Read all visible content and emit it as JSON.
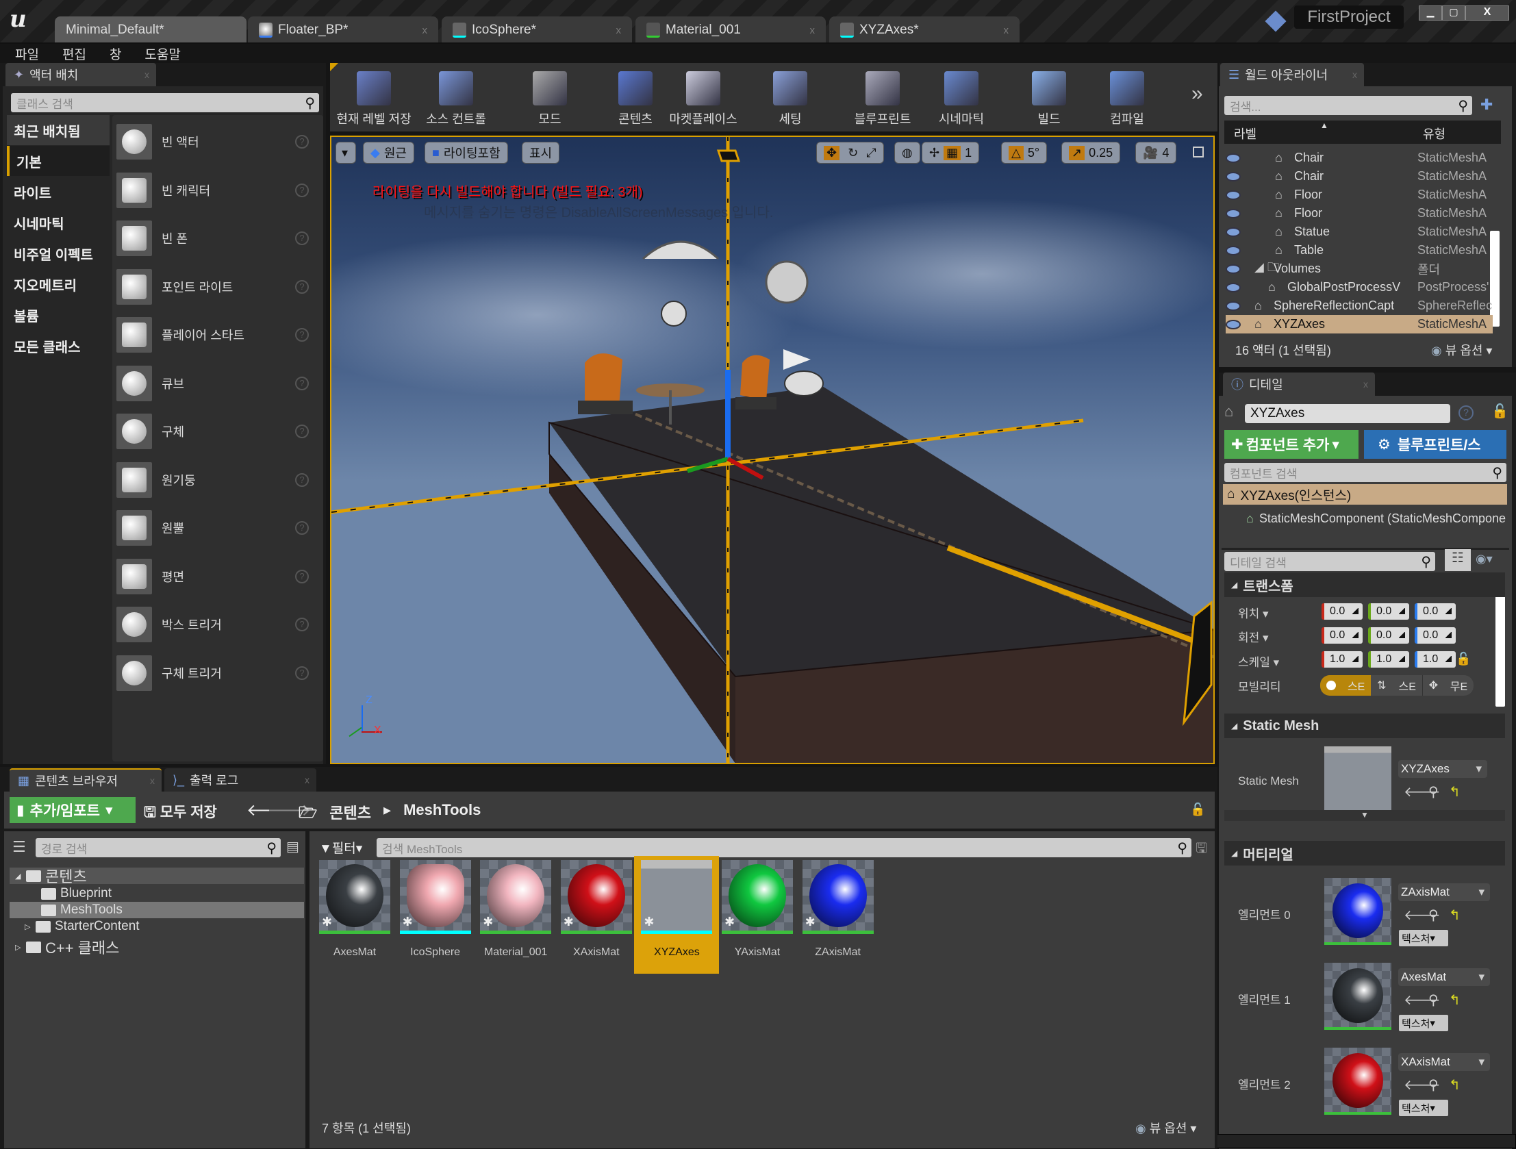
{
  "window": {
    "project": "FirstProject",
    "tabs": [
      "Minimal_Default*",
      "Floater_BP*",
      "IcoSphere*",
      "Material_001",
      "XYZAxes*"
    ]
  },
  "menu": [
    "파일",
    "편집",
    "창",
    "도움말"
  ],
  "place_actors": {
    "tab": "액터 배치",
    "search_placeholder": "클래스 검색",
    "categories": [
      "최근 배치됨",
      "기본",
      "라이트",
      "시네마틱",
      "비주얼 이펙트",
      "지오메트리",
      "볼륨",
      "모든 클래스"
    ],
    "items": [
      "빈 액터",
      "빈 캐릭터",
      "빈 폰",
      "포인트 라이트",
      "플레이어 스타트",
      "큐브",
      "구체",
      "원기둥",
      "원뿔",
      "평면",
      "박스 트리거",
      "구체 트리거"
    ]
  },
  "toolbar": [
    "현재 레벨 저장",
    "소스 컨트롤",
    "모드",
    "콘텐츠",
    "마켓플레이스",
    "세팅",
    "블루프린트",
    "시네마틱",
    "빌드",
    "컴파일"
  ],
  "viewport": {
    "perspective": "원근",
    "lit": "라이팅포함",
    "show": "표시",
    "grid": "1",
    "rot_snap": "5°",
    "scale_snap": "0.25",
    "cam_speed": "4",
    "warning": "라이팅을 다시 빌드해야 합니다 (빌드 필요: 3개)",
    "hint": "메시지를 숨기는 명령은 DisableAllScreenMessages 입니다.",
    "axis_z": "Z",
    "axis_x": "X"
  },
  "outliner": {
    "tab": "월드 아웃라이너",
    "search_placeholder": "검색...",
    "col_label": "라벨",
    "col_type": "유형",
    "rows": [
      {
        "label": "Chair",
        "type": "StaticMeshA"
      },
      {
        "label": "Chair",
        "type": "StaticMeshA"
      },
      {
        "label": "Floor",
        "type": "StaticMeshA"
      },
      {
        "label": "Floor",
        "type": "StaticMeshA"
      },
      {
        "label": "Statue",
        "type": "StaticMeshA"
      },
      {
        "label": "Table",
        "type": "StaticMeshA"
      },
      {
        "label": "Volumes",
        "type": "폴더"
      },
      {
        "label": "GlobalPostProcessV",
        "type": "PostProcess'"
      },
      {
        "label": "SphereReflectionCapt",
        "type": "SphereReflec"
      },
      {
        "label": "XYZAxes",
        "type": "StaticMeshA"
      }
    ],
    "status": "16 액터 (1 선택됨)",
    "view_options": "뷰 옵션"
  },
  "details": {
    "tab": "디테일",
    "name": "XYZAxes",
    "add_component": "컴포넌트 추가",
    "blueprint": "블루프린트/스",
    "component_search": "컴포넌트 검색",
    "instance": "XYZAxes(인스턴스)",
    "component": "StaticMeshComponent (StaticMeshCompone",
    "detail_search": "디테일 검색",
    "transform": {
      "title": "트랜스폼",
      "location_label": "위치",
      "rotation_label": "회전",
      "scale_label": "스케일",
      "location": [
        "0.0",
        "0.0",
        "0.0"
      ],
      "rotation": [
        "0.0",
        "0.0",
        "0.0"
      ],
      "scale": [
        "1.0",
        "1.0",
        "1.0"
      ],
      "mobility_label": "모빌리티",
      "mobility": [
        "스E",
        "스E",
        "무E"
      ]
    },
    "static_mesh": {
      "title": "Static Mesh",
      "label": "Static Mesh",
      "value": "XYZAxes"
    },
    "materials": {
      "title": "머티리얼",
      "texture": "텍스처",
      "elements": [
        {
          "label": "엘리먼트 0",
          "value": "ZAxisMat",
          "color": "#1a2cf0"
        },
        {
          "label": "엘리먼트 1",
          "value": "AxesMat",
          "color": "#3a3f44"
        },
        {
          "label": "엘리먼트 2",
          "value": "XAxisMat",
          "color": "#d01018"
        }
      ]
    }
  },
  "content_browser": {
    "tab": "콘텐츠 브라우저",
    "output_tab": "출력 로그",
    "add_import": "추가/임포트",
    "save_all": "모두 저장",
    "path": [
      "콘텐츠",
      "MeshTools"
    ],
    "path_search": "경로 검색",
    "filter": "필터",
    "asset_search": "검색 MeshTools",
    "tree": [
      "콘텐츠",
      "Blueprint",
      "MeshTools",
      "StarterContent",
      "C++ 클래스"
    ],
    "assets": [
      {
        "name": "AxesMat",
        "color": "#3a3f44"
      },
      {
        "name": "IcoSphere",
        "color": "#f0a8b0"
      },
      {
        "name": "Material_001",
        "color": "#f2b6c0"
      },
      {
        "name": "XAxisMat",
        "color": "#d01018"
      },
      {
        "name": "XYZAxes",
        "color": ""
      },
      {
        "name": "YAxisMat",
        "color": "#10c840"
      },
      {
        "name": "ZAxisMat",
        "color": "#1a2cf0"
      }
    ],
    "status": "7 항목 (1 선택됨)",
    "view_options": "뷰 옵션"
  }
}
